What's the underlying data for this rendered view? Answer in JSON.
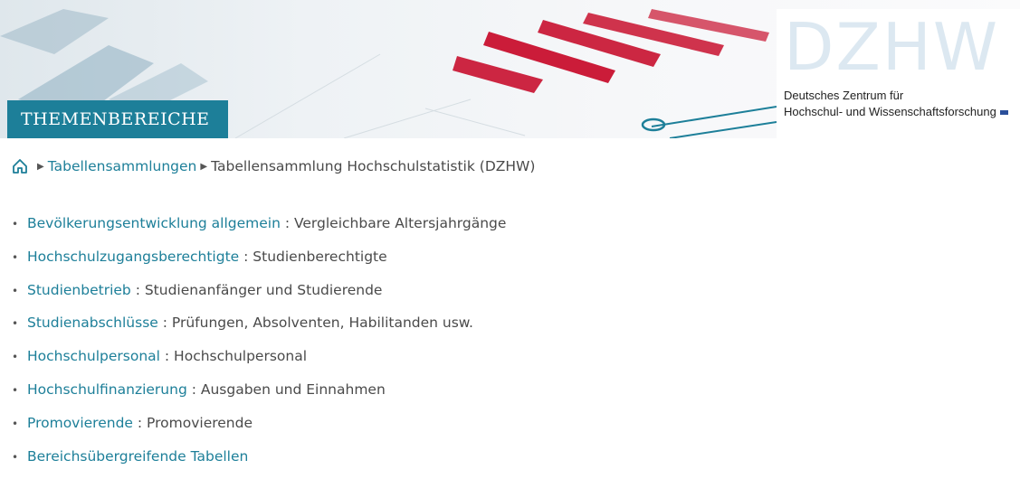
{
  "banner": {
    "theme_label": "THEMENBEREICHE",
    "logo": {
      "mark": "DZHW",
      "line1": "Deutsches Zentrum für",
      "line2": "Hochschul- und Wissenschaftsforschung"
    }
  },
  "breadcrumb": {
    "home_icon": "home-icon",
    "items": [
      "Tabellensammlungen",
      "Tabellensammlung Hochschulstatistik (DZHW)"
    ]
  },
  "topics": [
    {
      "link": "Bevölkerungsentwicklung allgemein",
      "desc": " : Vergleichbare Altersjahrgänge"
    },
    {
      "link": "Hochschulzugangsberechtigte",
      "desc": " : Studienberechtigte"
    },
    {
      "link": "Studienbetrieb",
      "desc": " : Studienanfänger und Studierende"
    },
    {
      "link": "Studienabschlüsse",
      "desc": " : Prüfungen, Absolventen, Habilitanden usw."
    },
    {
      "link": "Hochschulpersonal",
      "desc": " : Hochschulpersonal"
    },
    {
      "link": "Hochschulfinanzierung",
      "desc": " : Ausgaben und Einnahmen"
    },
    {
      "link": "Promovierende",
      "desc": " : Promovierende"
    },
    {
      "link": "Bereichsübergreifende Tabellen",
      "desc": ""
    }
  ],
  "colors": {
    "accent": "#1d7f99",
    "bar_red": "#c8102e"
  }
}
